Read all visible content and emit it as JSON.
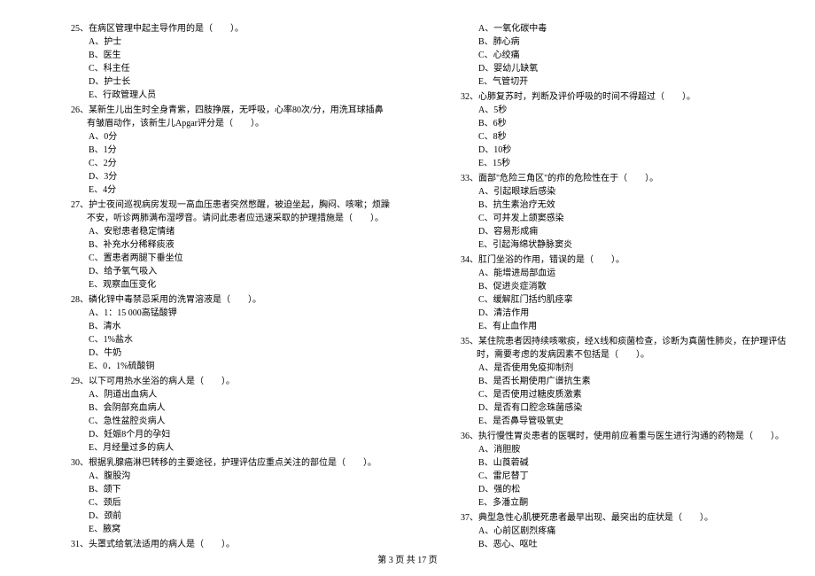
{
  "questions_left": [
    {
      "num": "25",
      "text": "在病区管理中起主导作用的是（　　）。",
      "options": [
        "A、护士",
        "B、医生",
        "C、科主任",
        "D、护士长",
        "E、行政管理人员"
      ]
    },
    {
      "num": "26",
      "text": "某新生儿出生时全身青紫，四肢挣展，无呼吸，心率80次/分，用洗耳球插鼻有皱眉动作，该新生儿Apgar评分是（　　）。",
      "options": [
        "A、0分",
        "B、1分",
        "C、2分",
        "D、3分",
        "E、4分"
      ]
    },
    {
      "num": "27",
      "text": "护士夜间巡视病房发现一高血压患者突然憋醒，被迫坐起，胸闷、咳嗽；烦躁不安，听诊两肺满布湿啰音。请问此患者应迅速采取的护理措施是（　　）。",
      "options": [
        "A、安慰患者稳定情绪",
        "B、补充水分稀释痰液",
        "C、置患者两腿下垂坐位",
        "D、给予氧气吸入",
        "E、观察血压变化"
      ]
    },
    {
      "num": "28",
      "text": "磷化锌中毒禁忌采用的洗胃溶液是（　　）。",
      "options": [
        "A、1：15 000高锰酸钾",
        "B、清水",
        "C、1%盐水",
        "D、牛奶",
        "E、0．1%硫酸铜"
      ]
    },
    {
      "num": "29",
      "text": "以下可用热水坐浴的病人是（　　）。",
      "options": [
        "A、阴道出血病人",
        "B、会阴部充血病人",
        "C、急性盆腔炎病人",
        "D、妊娠8个月的孕妇",
        "E、月经量过多的病人"
      ]
    },
    {
      "num": "30",
      "text": "根据乳腺癌淋巴转移的主要途径，护理评估应重点关注的部位是（　　）。",
      "options": [
        "A、腹股沟",
        "B、颌下",
        "C、颈后",
        "D、颈前",
        "E、腋窝"
      ]
    },
    {
      "num": "31",
      "text": "头罩式给氧法适用的病人是（　　）。",
      "options": []
    }
  ],
  "questions_right": [
    {
      "num": "",
      "text": "",
      "options": [
        "A、一氧化碳中毒",
        "B、肺心病",
        "C、心绞痛",
        "D、婴幼儿缺氧",
        "E、气管切开"
      ]
    },
    {
      "num": "32",
      "text": "心肺复苏时，判断及评价呼吸的时间不得超过（　　）。",
      "options": [
        "A、5秒",
        "B、6秒",
        "C、8秒",
        "D、10秒",
        "E、15秒"
      ]
    },
    {
      "num": "33",
      "text": "面部\"危险三角区\"的疖的危险性在于（　　）。",
      "options": [
        "A、引起眼球后感染",
        "B、抗生素治疗无效",
        "C、可并发上颌窦感染",
        "D、容易形成痈",
        "E、引起海绵状静脉窦炎"
      ]
    },
    {
      "num": "34",
      "text": "肛门坐浴的作用，错误的是（　　）。",
      "options": [
        "A、能增进局部血运",
        "B、促进炎症消散",
        "C、缓解肛门括约肌痉挛",
        "D、清洁作用",
        "E、有止血作用"
      ]
    },
    {
      "num": "35",
      "text": "某住院患者因持续咳嗽痰，经X线和痰菌检查，诊断为真菌性肺炎，在护理评估时，需要考虑的发病因素不包括是（　　）。",
      "options": [
        "A、是否使用免疫抑制剂",
        "B、是否长期使用广谱抗生素",
        "C、是否使用过糖皮质激素",
        "D、是否有口腔念珠菌感染",
        "E、是否鼻导管吸氧史"
      ]
    },
    {
      "num": "36",
      "text": "执行慢性胃炎患者的医嘱时，使用前应着重与医生进行沟通的药物是（　　）。",
      "options": [
        "A、消胆胺",
        "B、山莨菪碱",
        "C、雷尼替丁",
        "D、强的松",
        "E、多潘立酮"
      ]
    },
    {
      "num": "37",
      "text": "典型急性心肌梗死患者最早出现、最突出的症状是（　　）。",
      "options": [
        "A、心前区剧烈疼痛",
        "B、恶心、呕吐"
      ]
    }
  ],
  "footer": "第 3 页 共 17 页"
}
